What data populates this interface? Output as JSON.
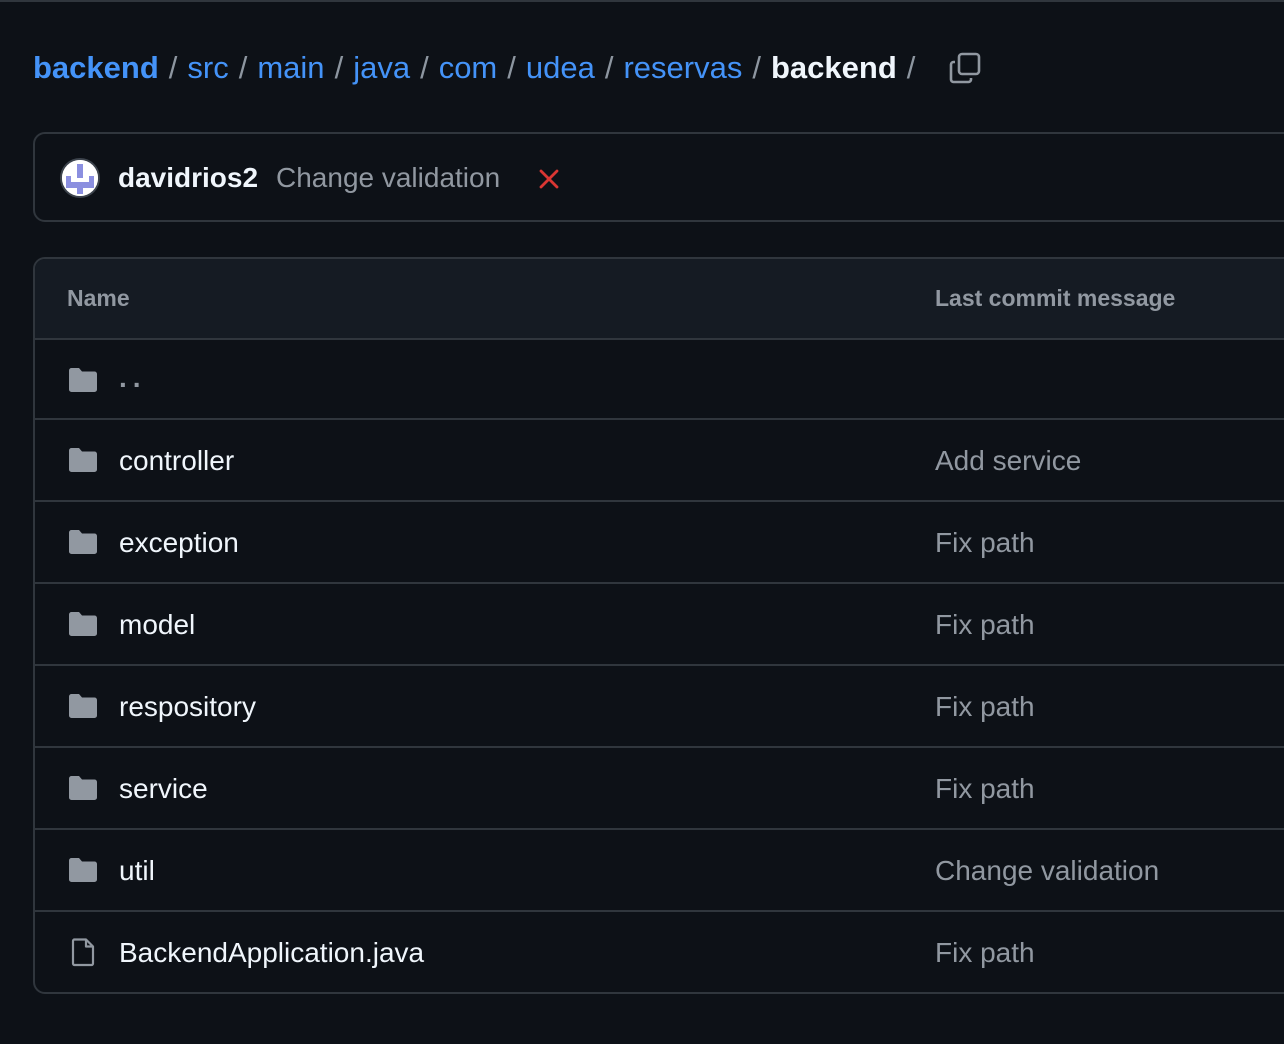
{
  "breadcrumb": {
    "root": "backend",
    "segments": [
      "src",
      "main",
      "java",
      "com",
      "udea",
      "reservas"
    ],
    "current": "backend",
    "separator": "/"
  },
  "latest_commit": {
    "author": "davidrios2",
    "message": "Change validation",
    "status": "failed",
    "status_icon": "x-icon",
    "status_color": "#da3633"
  },
  "table": {
    "headers": {
      "name": "Name",
      "last_commit_message": "Last commit message"
    },
    "parent_dir": "..",
    "rows": [
      {
        "type": "folder",
        "name": "controller",
        "message": "Add service"
      },
      {
        "type": "folder",
        "name": "exception",
        "message": "Fix path"
      },
      {
        "type": "folder",
        "name": "model",
        "message": "Fix path"
      },
      {
        "type": "folder",
        "name": "respository",
        "message": "Fix path"
      },
      {
        "type": "folder",
        "name": "service",
        "message": "Fix path"
      },
      {
        "type": "folder",
        "name": "util",
        "message": "Change validation"
      },
      {
        "type": "file",
        "name": "BackendApplication.java",
        "message": "Fix path"
      }
    ]
  },
  "colors": {
    "background": "#0d1117",
    "link": "#4493f8",
    "muted": "#9198a1",
    "border": "#30363d",
    "header_bg": "#151b23"
  }
}
